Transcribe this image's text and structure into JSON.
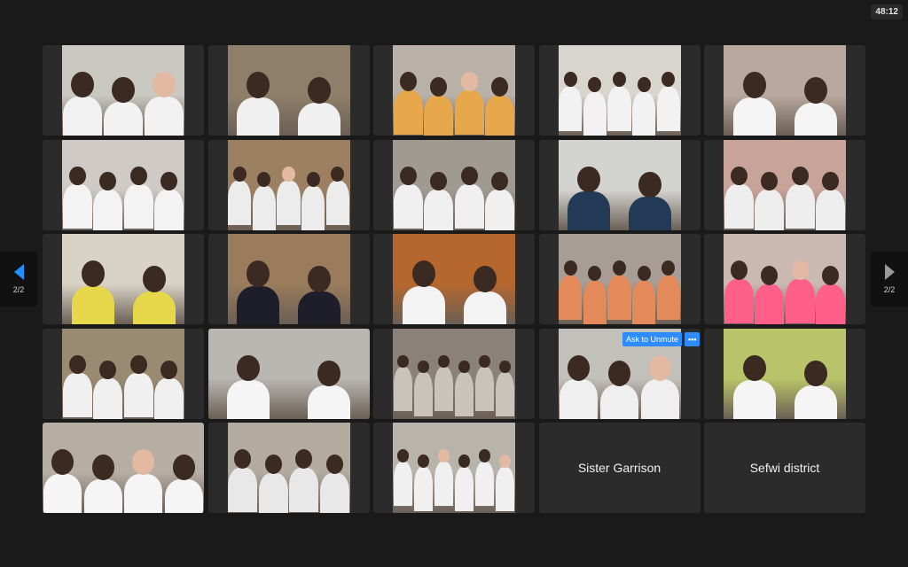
{
  "meeting": {
    "timer": "48:12",
    "page_indicator_left": "2/2",
    "page_indicator_right": "2/2"
  },
  "ask_to_unmute": {
    "label": "Ask to Unmute",
    "more_label": "•••"
  },
  "participants": [
    {
      "kind": "video",
      "bg": "#c9c9c2",
      "people": 3,
      "shirt": "#f2f2f2"
    },
    {
      "kind": "video",
      "bg": "#8f7f6a",
      "people": 2,
      "shirt": "#f0f0f0"
    },
    {
      "kind": "video",
      "bg": "#b9b1a8",
      "people": 4,
      "shirt": "#e6a84a"
    },
    {
      "kind": "video",
      "bg": "#d8d5cf",
      "people": 5,
      "shirt": "#f2f2f2"
    },
    {
      "kind": "video",
      "bg": "#b9a89e",
      "people": 2,
      "shirt": "#f5f5f5"
    },
    {
      "kind": "video",
      "bg": "#cfcac5",
      "people": 4,
      "shirt": "#f3f3f3"
    },
    {
      "kind": "video",
      "bg": "#9c8061",
      "people": 5,
      "shirt": "#ececec"
    },
    {
      "kind": "video",
      "bg": "#a09a92",
      "people": 4,
      "shirt": "#f0f0f0"
    },
    {
      "kind": "video",
      "bg": "#d3d3d0",
      "people": 2,
      "shirt": "#223a55"
    },
    {
      "kind": "video",
      "bg": "#c7a39a",
      "people": 4,
      "shirt": "#eeeeee"
    },
    {
      "kind": "video",
      "bg": "#d9d3c5",
      "people": 2,
      "shirt": "#e6d84a"
    },
    {
      "kind": "video",
      "bg": "#9a7c5c",
      "people": 2,
      "shirt": "#1e1e2a"
    },
    {
      "kind": "video",
      "bg": "#b5672e",
      "people": 2,
      "shirt": "#f3f3f3"
    },
    {
      "kind": "video",
      "bg": "#a79c96",
      "people": 5,
      "shirt": "#e48a5a"
    },
    {
      "kind": "video",
      "bg": "#c9b9b0",
      "people": 4,
      "shirt": "#ff5f8a"
    },
    {
      "kind": "video",
      "bg": "#9b8a72",
      "people": 4,
      "shirt": "#f0f0f0"
    },
    {
      "kind": "video",
      "bg": "#b9b7b2",
      "people": 2,
      "shirt": "#f5f5f5"
    },
    {
      "kind": "video",
      "bg": "#8a8278",
      "people": 6,
      "shirt": "#c9c3bc"
    },
    {
      "kind": "video",
      "bg": "#c2c0ba",
      "people": 3,
      "shirt": "#efefef"
    },
    {
      "kind": "video",
      "bg": "#b9c46a",
      "people": 2,
      "shirt": "#f5f5f5"
    },
    {
      "kind": "video",
      "bg": "#b7aea3",
      "people": 4,
      "shirt": "#f5f5f5"
    },
    {
      "kind": "video",
      "bg": "#b3aaa0",
      "people": 4,
      "shirt": "#e8e8e8"
    },
    {
      "kind": "video",
      "bg": "#b8b3ab",
      "people": 6,
      "shirt": "#f0f0f0"
    },
    {
      "kind": "name",
      "name": "Sister Garrison"
    },
    {
      "kind": "name",
      "name": "Sefwi district"
    }
  ]
}
